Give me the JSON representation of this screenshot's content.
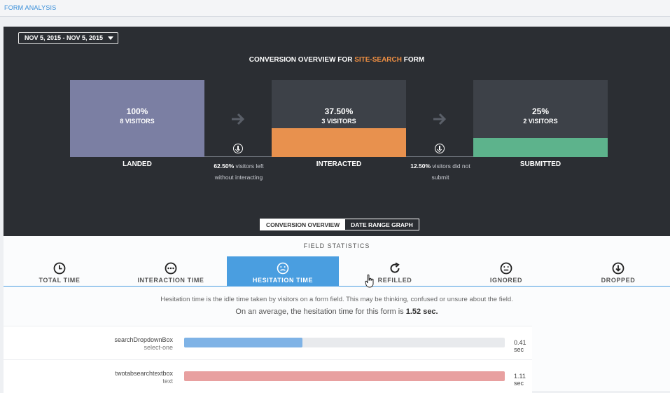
{
  "header": {
    "title": "FORM ANALYSIS"
  },
  "overview": {
    "date_range": "NOV 5, 2015 - NOV 5, 2015",
    "title_prefix": "CONVERSION OVERVIEW FOR ",
    "form_name": "SITE-SEARCH",
    "title_suffix": " FORM",
    "stages": [
      {
        "label": "LANDED",
        "percent": "100%",
        "visitors": "8 VISITORS",
        "fill_fraction": 1.0,
        "color": "#7b7fa3"
      },
      {
        "label": "INTERACTED",
        "percent": "37.50%",
        "visitors": "3 VISITORS",
        "fill_fraction": 0.375,
        "color": "#e8914e"
      },
      {
        "label": "SUBMITTED",
        "percent": "25%",
        "visitors": "2 VISITORS",
        "fill_fraction": 0.25,
        "color": "#5db38c"
      }
    ],
    "dropoffs": [
      {
        "percent": "62.50%",
        "line1": " visitors left",
        "line2": "without interacting"
      },
      {
        "percent": "12.50%",
        "line1": " visitors did not",
        "line2": "submit"
      }
    ],
    "toggle": {
      "active": "CONVERSION OVERVIEW",
      "inactive": "DATE RANGE GRAPH"
    }
  },
  "field_stats": {
    "title": "FIELD STATISTICS",
    "tabs": [
      {
        "label": "TOTAL TIME",
        "icon": "clock-icon",
        "active": false
      },
      {
        "label": "INTERACTION TIME",
        "icon": "dots-face-icon",
        "active": false
      },
      {
        "label": "HESITATION TIME",
        "icon": "neutral-face-icon",
        "active": true
      },
      {
        "label": "REFILLED",
        "icon": "refresh-icon",
        "active": false
      },
      {
        "label": "IGNORED",
        "icon": "ignored-face-icon",
        "active": false
      },
      {
        "label": "DROPPED",
        "icon": "down-circle-icon",
        "active": false
      }
    ],
    "description": "Hesitation time is the idle time taken by visitors on a form field. This may be thinking, confused or unsure about the field.",
    "average_prefix": "On an average, the hesitation time for this form is ",
    "average_value": "1.52 sec.",
    "rows": [
      {
        "name": "searchDropdownBox",
        "type": "select-one",
        "value": "0.41 sec",
        "fraction": 0.37,
        "color": "#7fb3e6"
      },
      {
        "name": "twotabsearchtextbox",
        "type": "text",
        "value": "1.11 sec",
        "fraction": 1.0,
        "color": "#e8a0a0"
      }
    ]
  }
}
